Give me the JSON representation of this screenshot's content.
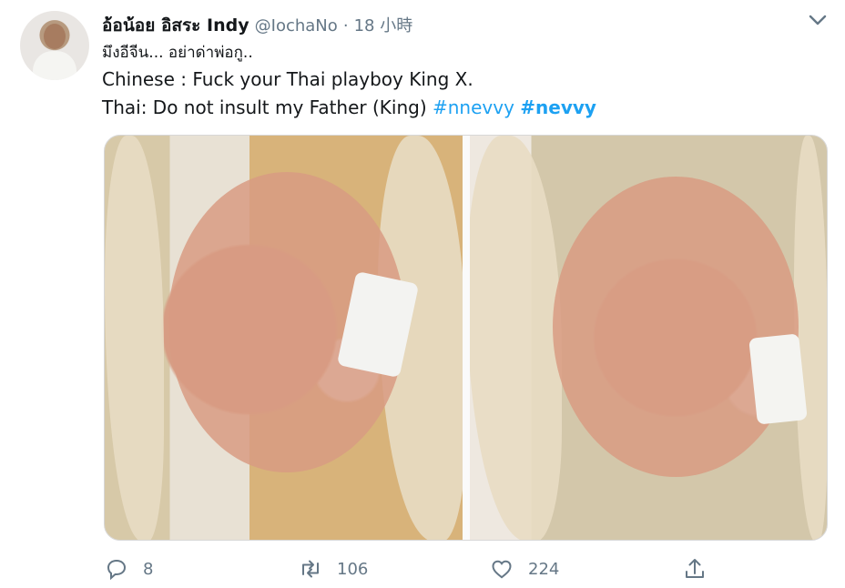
{
  "tweet": {
    "author_name": "อ้อน้อย อิสระ Indy",
    "author_handle": "@IochaNo",
    "separator": "·",
    "time": "18 小時",
    "line1": "มึงอีจีน... อย่าด่าพ่อกู..",
    "line2": "Chinese : Fuck your Thai playboy King X.",
    "line3_prefix": "Thai: Do not insult my Father (King) ",
    "hashtag1": "#nnevvy",
    "hashtag2": "#nevvy"
  },
  "actions": {
    "reply_count": "8",
    "retweet_count": "106",
    "like_count": "224"
  },
  "icons": [
    "chevron-down-icon",
    "reply-icon",
    "retweet-icon",
    "like-icon",
    "share-icon"
  ],
  "colors": {
    "link": "#1da1f2",
    "secondary": "#657786",
    "text": "#14171a"
  }
}
